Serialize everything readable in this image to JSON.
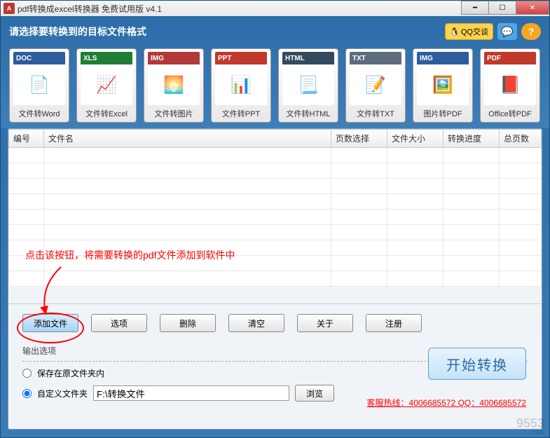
{
  "titlebar": {
    "icon_text": "A",
    "title": "pdf转换成excel转换器 免费试用版 v4.1"
  },
  "header": {
    "title": "请选择要转换到的目标文件格式",
    "qq_label": "QQ交谈",
    "help_label": "?"
  },
  "formats": [
    {
      "hdr": "DOC",
      "label": "文件转Word",
      "cls": "doc",
      "body": "📄"
    },
    {
      "hdr": "XLS",
      "label": "文件转Excel",
      "cls": "xls",
      "body": "📈"
    },
    {
      "hdr": "IMG",
      "label": "文件转图片",
      "cls": "img",
      "body": "🌅"
    },
    {
      "hdr": "PPT",
      "label": "文件转PPT",
      "cls": "ppt",
      "body": "📊"
    },
    {
      "hdr": "HTML",
      "label": "文件转HTML",
      "cls": "html",
      "body": "📃"
    },
    {
      "hdr": "TXT",
      "label": "文件转TXT",
      "cls": "txt",
      "body": "📝"
    },
    {
      "hdr": "IMG",
      "label": "图片转PDF",
      "cls": "img2",
      "body": "🖼️"
    },
    {
      "hdr": "PDF",
      "label": "Office转PDF",
      "cls": "pdf",
      "body": "📕"
    }
  ],
  "table": {
    "columns": [
      "编号",
      "文件名",
      "页数选择",
      "文件大小",
      "转换进度",
      "总页数"
    ]
  },
  "annotation": "点击该按钮，将需要转换的pdf文件添加到软件中",
  "buttons": {
    "add": "添加文件",
    "options": "选项",
    "delete": "删除",
    "clear": "清空",
    "about": "关于",
    "register": "注册"
  },
  "output": {
    "title": "输出选项",
    "radio_same": "保存在原文件夹内",
    "radio_custom": "自定义文件夹",
    "path_value": "F:\\转换文件",
    "browse": "浏览",
    "start": "开始转换"
  },
  "hotline": "客服热线：4006685572 QQ：4006685572",
  "watermark": {
    "main": "9553",
    "sub": ".com"
  }
}
